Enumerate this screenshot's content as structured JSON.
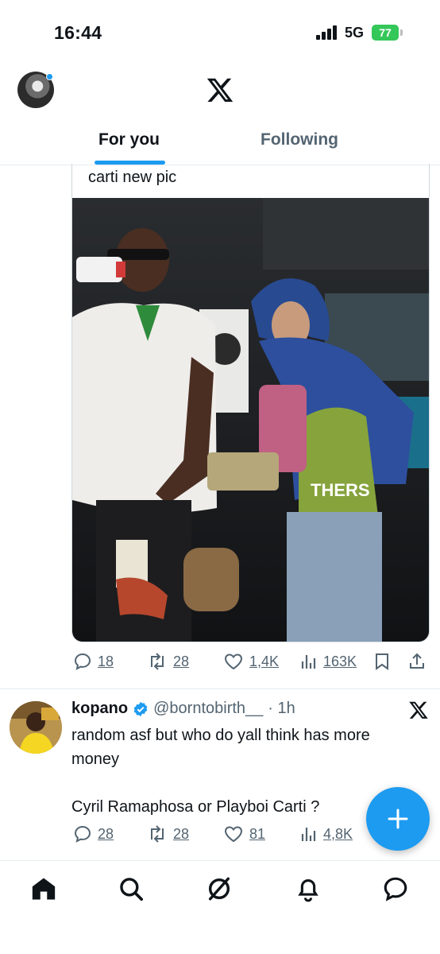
{
  "status_bar": {
    "time": "16:44",
    "network": "5G",
    "battery": "77"
  },
  "tabs": [
    {
      "label": "For you",
      "active": true
    },
    {
      "label": "Following",
      "active": false
    }
  ],
  "quote": {
    "text": "carti new pic",
    "actions": {
      "replies": "18",
      "reposts": "28",
      "likes": "1,4K",
      "views": "163K"
    }
  },
  "tweet2": {
    "name": "kopano",
    "handle": "@borntobirth__",
    "time": "· 1h",
    "text": "random asf but who do yall think has more money\n\nCyril Ramaphosa or Playboi Carti ?",
    "actions": {
      "replies": "28",
      "reposts": "28",
      "likes": "81",
      "views": "4,8K"
    }
  },
  "colors": {
    "accent": "#1d9bf0",
    "secondary_text": "#536471",
    "battery": "#34c759"
  },
  "icons": [
    "x-logo-icon",
    "reply-icon",
    "repost-icon",
    "like-icon",
    "views-icon",
    "bookmark-icon",
    "share-icon",
    "verified-icon",
    "compose-icon",
    "home-icon",
    "search-icon",
    "grok-icon",
    "notifications-icon",
    "messages-icon"
  ]
}
